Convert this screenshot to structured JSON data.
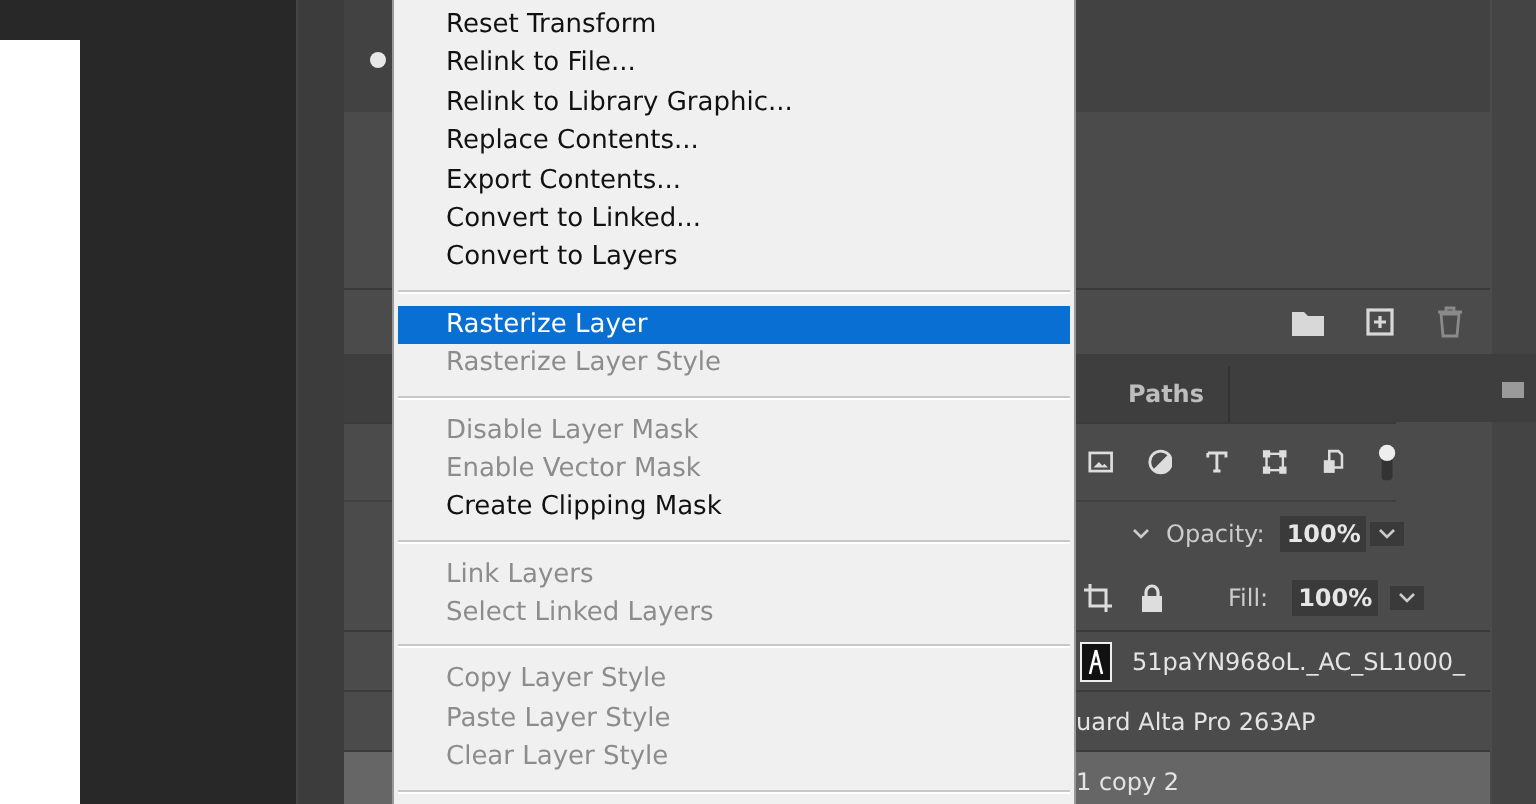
{
  "context_menu": {
    "groups": [
      {
        "items": [
          {
            "label": "Reset Transform",
            "disabled": false,
            "selected": false
          },
          {
            "label": "Relink to File...",
            "disabled": false,
            "selected": false
          },
          {
            "label": "Relink to Library Graphic...",
            "disabled": false,
            "selected": false
          },
          {
            "label": "Replace Contents...",
            "disabled": false,
            "selected": false
          },
          {
            "label": "Export Contents...",
            "disabled": false,
            "selected": false
          },
          {
            "label": "Convert to Linked...",
            "disabled": false,
            "selected": false
          },
          {
            "label": "Convert to Layers",
            "disabled": false,
            "selected": false
          }
        ]
      },
      {
        "items": [
          {
            "label": "Rasterize Layer",
            "disabled": false,
            "selected": true
          },
          {
            "label": "Rasterize Layer Style",
            "disabled": true,
            "selected": false
          }
        ]
      },
      {
        "items": [
          {
            "label": "Disable Layer Mask",
            "disabled": true,
            "selected": false
          },
          {
            "label": "Enable Vector Mask",
            "disabled": true,
            "selected": false
          },
          {
            "label": "Create Clipping Mask",
            "disabled": false,
            "selected": false
          }
        ]
      },
      {
        "items": [
          {
            "label": "Link Layers",
            "disabled": true,
            "selected": false
          },
          {
            "label": "Select Linked Layers",
            "disabled": true,
            "selected": false
          }
        ]
      },
      {
        "items": [
          {
            "label": "Copy Layer Style",
            "disabled": true,
            "selected": false
          },
          {
            "label": "Paste Layer Style",
            "disabled": true,
            "selected": false
          },
          {
            "label": "Clear Layer Style",
            "disabled": true,
            "selected": false
          }
        ]
      }
    ]
  },
  "layers_panel": {
    "tabs": [
      {
        "label": "Paths",
        "selected": false
      }
    ],
    "opacity": {
      "label": "Opacity:",
      "value": "100%"
    },
    "fill": {
      "label": "Fill:",
      "value": "100%"
    },
    "layers": [
      {
        "name": "51paYN968oL._AC_SL1000_",
        "thumbnail": true,
        "selected": false
      },
      {
        "name": "uard Alta Pro 263AP",
        "thumbnail": false,
        "selected": false
      },
      {
        "name": "1 copy 2",
        "thumbnail": false,
        "selected": true
      }
    ]
  }
}
